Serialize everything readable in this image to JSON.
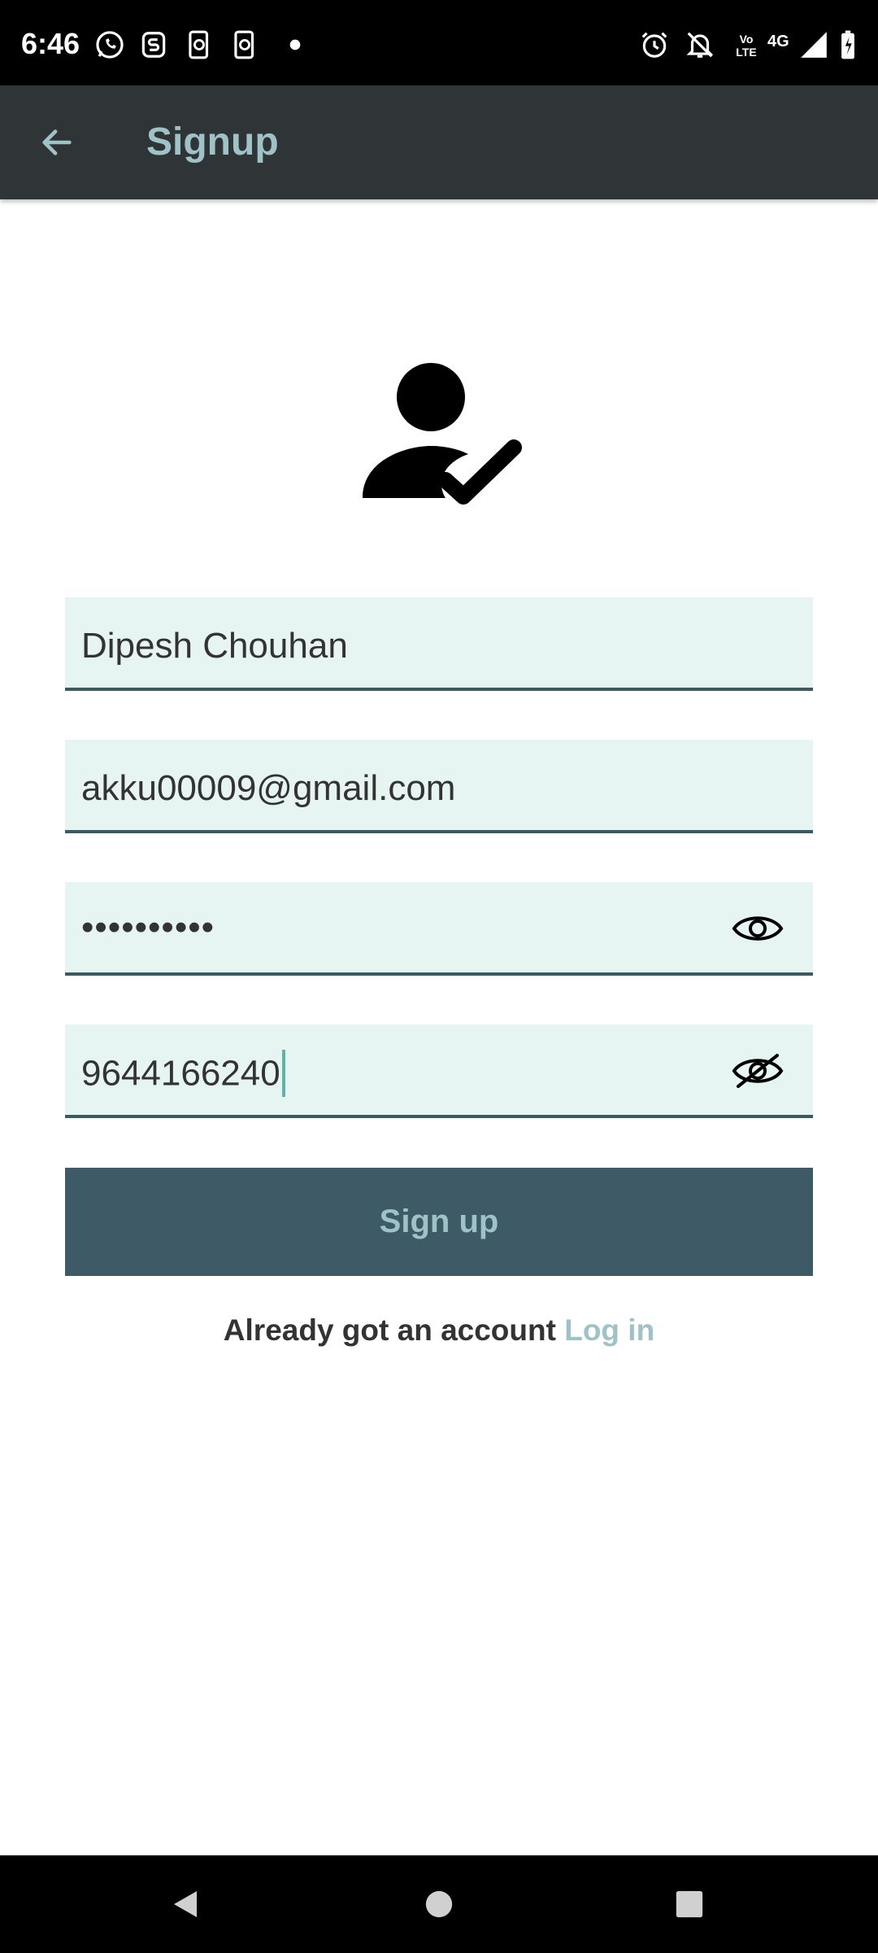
{
  "status_bar": {
    "time": "6:46",
    "left_icons": [
      "whatsapp-icon",
      "s-app-icon",
      "phone-sync-icon",
      "phone-sync-icon",
      "dot-icon"
    ],
    "right_icons": [
      "alarm-icon",
      "notifications-off-icon",
      "volte-icon",
      "4g-icon",
      "signal-icon",
      "battery-icon"
    ],
    "volte_label_top": "Vo",
    "volte_label_bottom": "LTE",
    "network_label": "4G"
  },
  "app_bar": {
    "title": "Signup",
    "back_icon": "arrow-back-icon",
    "background": "#2f3537",
    "title_color": "#9fc2c6"
  },
  "hero": {
    "icon": "person-check-icon"
  },
  "form": {
    "name_value": "Dipesh Chouhan",
    "email_value": "akku00009@gmail.com",
    "password_value": "••••••••••",
    "password_toggle_icon": "eye-icon",
    "phone_value": "9644166240",
    "phone_toggle_icon": "eye-off-icon",
    "field_background": "#e6f5f2",
    "field_underline": "#3c5a63"
  },
  "signup_button": {
    "label": "Sign up",
    "background": "#3d5a66",
    "text_color": "#9fc2c6"
  },
  "login_prompt": {
    "text": "Already got an account",
    "link": "Log in"
  },
  "nav_bar": {
    "icons": [
      "nav-back-icon",
      "nav-home-icon",
      "nav-recents-icon"
    ]
  }
}
